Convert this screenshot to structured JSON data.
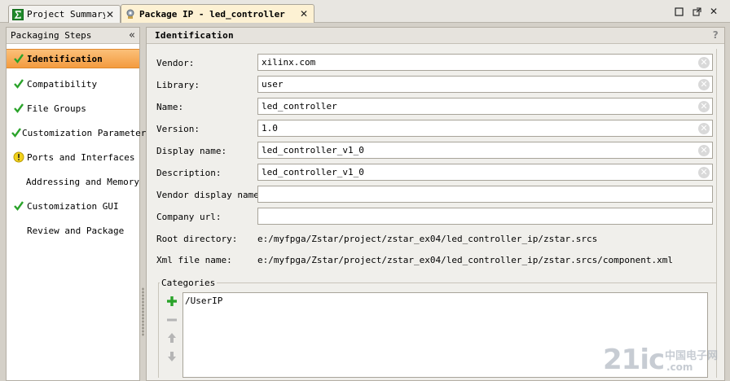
{
  "tabs": [
    {
      "label": "Project Summary",
      "icon": "sigma-icon"
    },
    {
      "label": "Package IP - led_controller",
      "icon": "gear-package-icon"
    }
  ],
  "window_controls": {
    "restore": "restore-icon",
    "maximize": "maximize-icon",
    "close": "close-icon"
  },
  "left_panel": {
    "title": "Packaging Steps",
    "steps": [
      {
        "label": "Identification",
        "status": "complete",
        "active": true
      },
      {
        "label": "Compatibility",
        "status": "complete"
      },
      {
        "label": "File Groups",
        "status": "complete"
      },
      {
        "label": "Customization Parameters",
        "status": "complete"
      },
      {
        "label": "Ports and Interfaces",
        "status": "warning"
      },
      {
        "label": "Addressing and Memory",
        "status": "none"
      },
      {
        "label": "Customization GUI",
        "status": "complete"
      },
      {
        "label": "Review and Package",
        "status": "none"
      }
    ]
  },
  "main": {
    "title": "Identification",
    "help": "?",
    "fields": {
      "vendor": {
        "label": "Vendor:",
        "value": "xilinx.com"
      },
      "library": {
        "label": "Library:",
        "value": "user"
      },
      "name": {
        "label": "Name:",
        "value": "led_controller"
      },
      "version": {
        "label": "Version:",
        "value": "1.0"
      },
      "display_name": {
        "label": "Display name:",
        "value": "led_controller_v1_0"
      },
      "description": {
        "label": "Description:",
        "value": "led_controller_v1_0"
      },
      "vendor_display_name": {
        "label": "Vendor display name:",
        "value": ""
      },
      "company_url": {
        "label": "Company url:",
        "value": ""
      }
    },
    "root_directory": {
      "label": "Root directory:",
      "value": "e:/myfpga/Zstar/project/zstar_ex04/led_controller_ip/zstar.srcs"
    },
    "xml_file_name": {
      "label": "Xml file name:",
      "value": "e:/myfpga/Zstar/project/zstar_ex04/led_controller_ip/zstar.srcs/component.xml"
    },
    "categories": {
      "title": "Categories",
      "items": [
        "/UserIP"
      ]
    }
  },
  "watermark": {
    "main": "21ic",
    "cn": "中国电子网",
    "com": ".com"
  },
  "colors": {
    "active_step": "#f39b3f",
    "check": "#2aa32a",
    "warning": "#f2d21b",
    "add": "#2aa32a"
  }
}
